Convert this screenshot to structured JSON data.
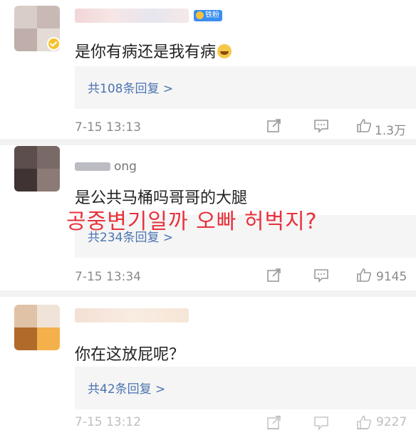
{
  "comments": [
    {
      "badge": "铁粉",
      "text": "是你有病还是我有病",
      "reply_link": "共108条回复 >",
      "time": "7-15 13:13",
      "likes": "1.3万"
    },
    {
      "username_partial": "ong",
      "text": "是公共马桶吗哥哥的大腿",
      "reply_link": "共234条回复 >",
      "time": "7-15 13:34",
      "likes": "9145"
    },
    {
      "text": "你在这放屁呢？",
      "reply_link": "共42条回复 >",
      "time": "7-15 13:12",
      "likes": "9227"
    }
  ],
  "overlay_translation": "공중변기일까 오빠 허벅지?",
  "icons": [
    "verified-badge-icon",
    "emoji-sweat-smile-icon",
    "share-icon",
    "comment-icon",
    "like-icon"
  ],
  "colors": {
    "reply_link": "#4b74b0",
    "overlay_text": "#e8323c",
    "badge": "#3b8ef0",
    "meta": "#8a8a8a"
  }
}
